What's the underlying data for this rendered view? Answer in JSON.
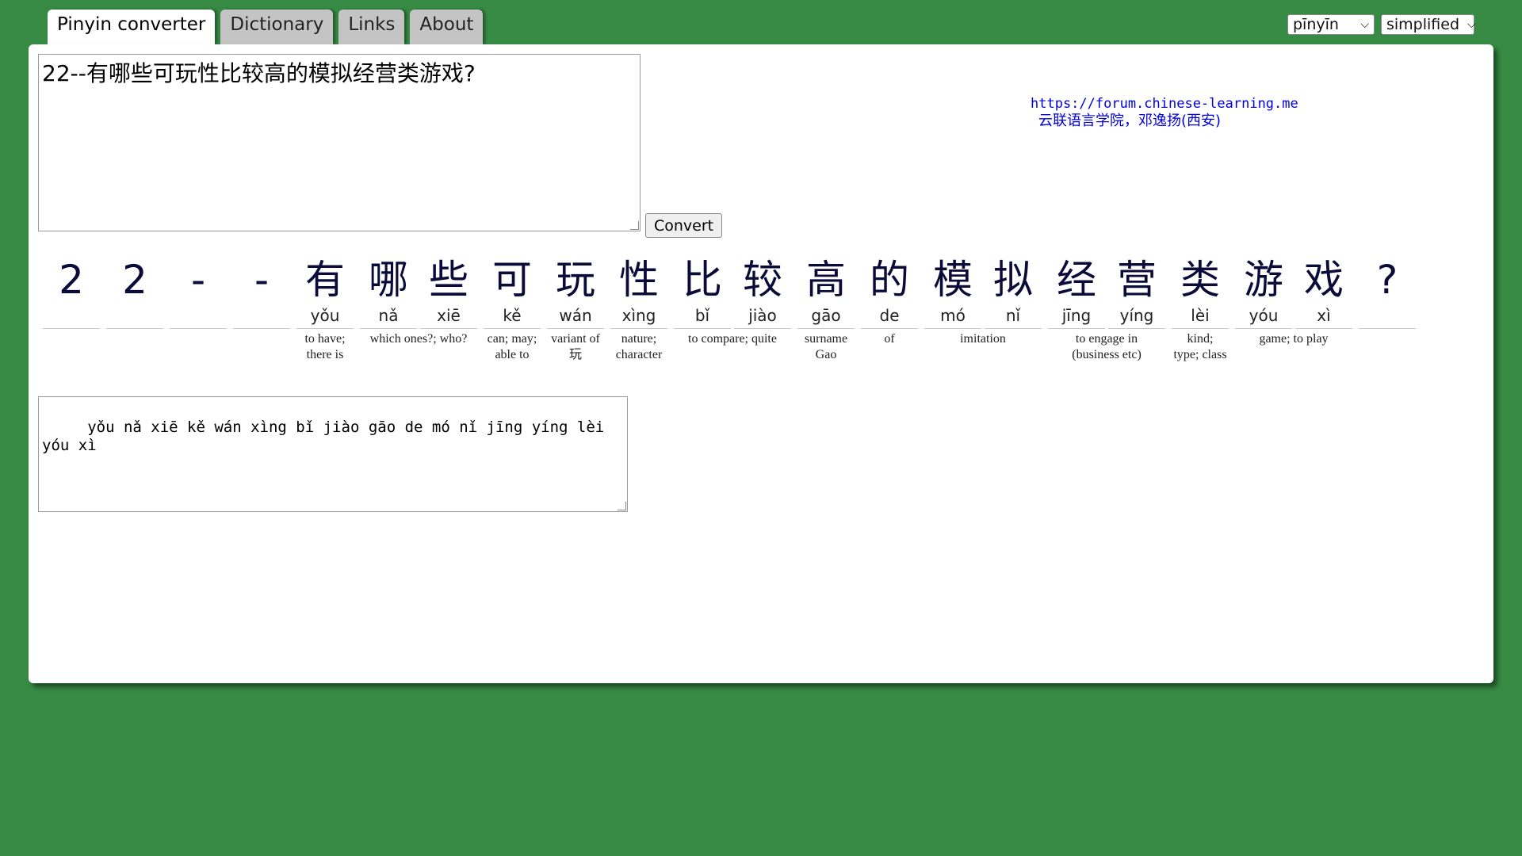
{
  "tabs": [
    {
      "label": "Pinyin converter",
      "active": true
    },
    {
      "label": "Dictionary",
      "active": false
    },
    {
      "label": "Links",
      "active": false
    },
    {
      "label": "About",
      "active": false
    }
  ],
  "selects": {
    "romanization": "pīnyīn",
    "script": "simplified"
  },
  "input": {
    "value": "22--有哪些可玩性比较高的模拟经营类游戏?"
  },
  "convert_label": "Convert",
  "links": {
    "url": "https://forum.chinese-learning.me",
    "org": "云联语言学院，邓逸扬(西安)"
  },
  "characters": [
    {
      "han": "2",
      "py": ""
    },
    {
      "han": "2",
      "py": ""
    },
    {
      "han": "-",
      "py": ""
    },
    {
      "han": "-",
      "py": ""
    },
    {
      "han": "有",
      "py": "yǒu"
    },
    {
      "han": "哪",
      "py": "nǎ"
    },
    {
      "han": "些",
      "py": "xiē"
    },
    {
      "han": "可",
      "py": "kě"
    },
    {
      "han": "玩",
      "py": "wán"
    },
    {
      "han": "性",
      "py": "xìng"
    },
    {
      "han": "比",
      "py": "bǐ"
    },
    {
      "han": "较",
      "py": "jiào"
    },
    {
      "han": "高",
      "py": "gāo"
    },
    {
      "han": "的",
      "py": "de"
    },
    {
      "han": "模",
      "py": "mó"
    },
    {
      "han": "拟",
      "py": "nǐ"
    },
    {
      "han": "经",
      "py": "jīng"
    },
    {
      "han": "营",
      "py": "yíng"
    },
    {
      "han": "类",
      "py": "lèi"
    },
    {
      "han": "游",
      "py": "yóu"
    },
    {
      "han": "戏",
      "py": "xì"
    },
    {
      "han": "?",
      "py": ""
    }
  ],
  "definitions": [
    {
      "text": "to have;\nthere is"
    },
    {
      "text": "which ones?; who?"
    },
    {
      "text": "can; may;\nable to"
    },
    {
      "text": "variant of\n玩"
    },
    {
      "text": "nature;\ncharacter"
    },
    {
      "text": "to compare; quite"
    },
    {
      "text": "surname\nGao"
    },
    {
      "text": "of"
    },
    {
      "text": "imitation"
    },
    {
      "text": "to engage in\n(business etc)"
    },
    {
      "text": "kind;\ntype; class"
    },
    {
      "text": "game; to play"
    }
  ],
  "output": {
    "value": "   yǒu nǎ xiē kě wán xìng bǐ jiào gāo de mó nǐ jīng yíng lèi\nyóu xì"
  }
}
